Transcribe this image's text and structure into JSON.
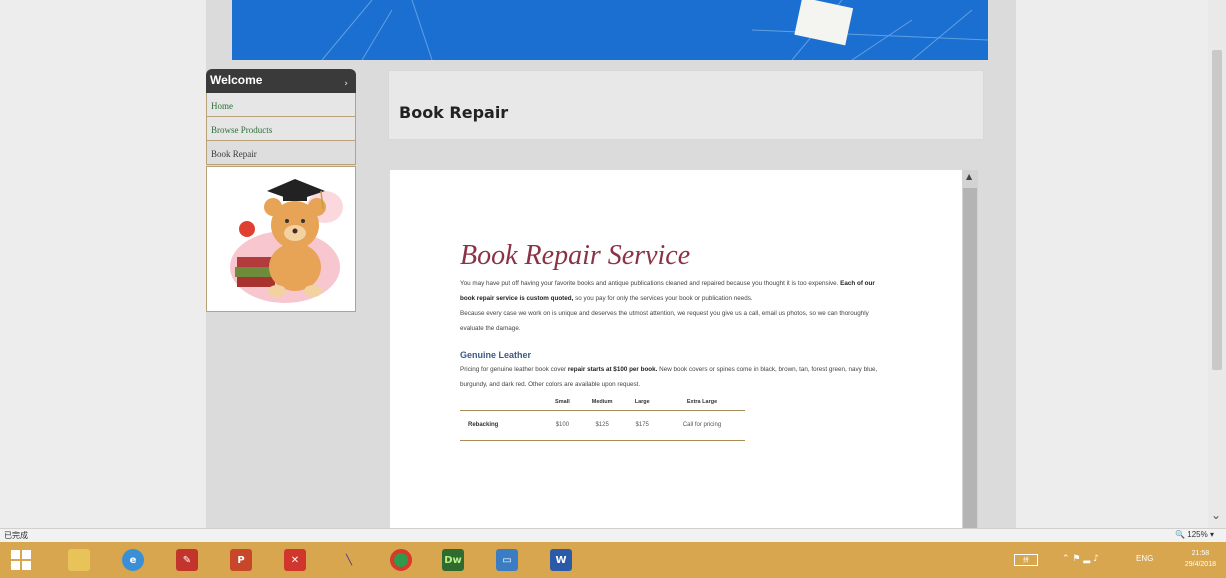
{
  "sidebar": {
    "header": "Welcome",
    "items": [
      {
        "label": "Home"
      },
      {
        "label": "Browse Products"
      },
      {
        "label": "Book Repair"
      }
    ]
  },
  "page": {
    "title": "Book Repair"
  },
  "document": {
    "heading": "Book Repair Service",
    "intro_1": "You may have put off having your favorite books and antique publications cleaned and repaired because you thought it is too expensive.",
    "intro_bold": "Each of our book repair service is custom quoted,",
    "intro_2": "so you pay for only the services your book or publication needs.",
    "intro_3": "Because every case we work on is unique and deserves the utmost attention, we request you give us a call, email us photos, so we can thoroughly evaluate the damage.",
    "section_title": "Genuine Leather",
    "section_1": "Pricing for genuine leather book cover",
    "section_bold": "repair starts at $100 per book.",
    "section_2": "New book covers or spines come in black, brown, tan, forest green, navy blue, burgundy, and dark red. Other colors are available upon request.",
    "table": {
      "headers": [
        "",
        "Small",
        "Medium",
        "Large",
        "Extra Large"
      ],
      "rows": [
        [
          "Rebacking",
          "$100",
          "$125",
          "$175",
          "Call for pricing"
        ]
      ]
    }
  },
  "statusbar": {
    "left": "已完成",
    "zoom": "125%"
  },
  "taskbar": {
    "apps": [
      "windows-start",
      "file-explorer",
      "internet-explorer",
      "paint-app",
      "powerpoint",
      "xmind",
      "pen-app",
      "chrome",
      "dreamweaver",
      "remote-desktop",
      "word"
    ],
    "dw_label": "Dw",
    "ppt_label": "P",
    "word_label": "W",
    "lang": "ENG",
    "time": "21:58",
    "date": "29/4/2018",
    "kbd": "拼"
  },
  "colors": {
    "banner": "#1b6fd0",
    "taskbar": "#d7a64e",
    "heading": "#8a3346",
    "section": "#3e5a80"
  }
}
